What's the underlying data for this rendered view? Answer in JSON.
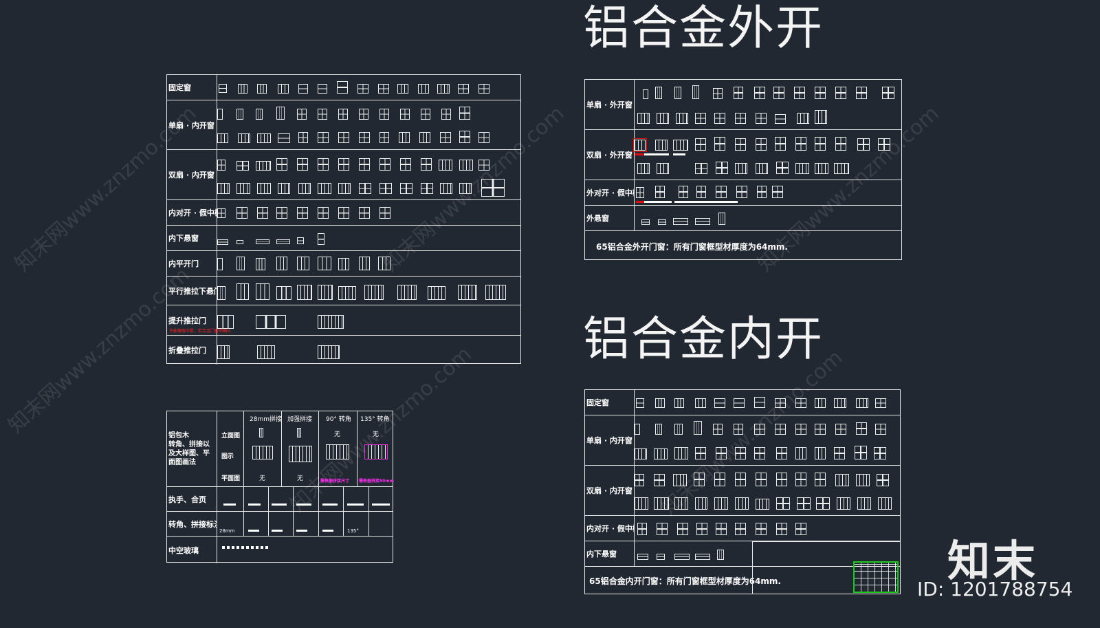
{
  "title_outward": "铝合金外开",
  "title_inward": "铝合金内开",
  "logo": "知末",
  "id_label": "ID: 1201788754",
  "watermark": "知末网www.znzmo.com",
  "left_table": {
    "rows": [
      {
        "label": "固定窗"
      },
      {
        "label": "单扇 · 内开窗"
      },
      {
        "label": "双扇 · 内开窗"
      },
      {
        "label": "内对开 · 假中梃"
      },
      {
        "label": "内下悬窗"
      },
      {
        "label": "内平开门"
      },
      {
        "label": "平行推拉下悬门"
      },
      {
        "label": "提升推拉门"
      },
      {
        "label": "折叠推拉门"
      }
    ],
    "lift_note": "不能做假中梃，铝合金门窗须确认"
  },
  "outward_table": {
    "rows": [
      {
        "label": "单扇 · 外开窗"
      },
      {
        "label": "双扇 · 外开窗"
      },
      {
        "label": "外对开 · 假中梃"
      },
      {
        "label": "外悬窗"
      }
    ],
    "note": "65铝合金外开门窗：所有门窗框型材厚度为64mm."
  },
  "inward_table": {
    "rows": [
      {
        "label": "固定窗"
      },
      {
        "label": "单扇 · 内开窗"
      },
      {
        "label": "双扇 · 内开窗"
      },
      {
        "label": "内对开 · 假中梃"
      },
      {
        "label": "内下悬窗"
      }
    ],
    "note": "65铝合金内开门窗：所有门窗框型材厚度为64mm."
  },
  "detail_table": {
    "main_label": "铝包木\n转角、拼接以\n及大样图、平\n面图画法",
    "sub_labels": [
      "立面图",
      "图示",
      "平面图"
    ],
    "col_headers": [
      "28mm拼接",
      "加强拼接",
      "90° 转角",
      "135° 转角"
    ],
    "none_text": "无",
    "pink_notes": [
      "需根据拼接尺寸",
      "需根据拼接50mm"
    ],
    "row_handles": "执手、合页",
    "row_marks": "转角、拼接标注",
    "row_glass": "中空玻璃",
    "dim_28": "28mm",
    "dim_135": "135°"
  }
}
